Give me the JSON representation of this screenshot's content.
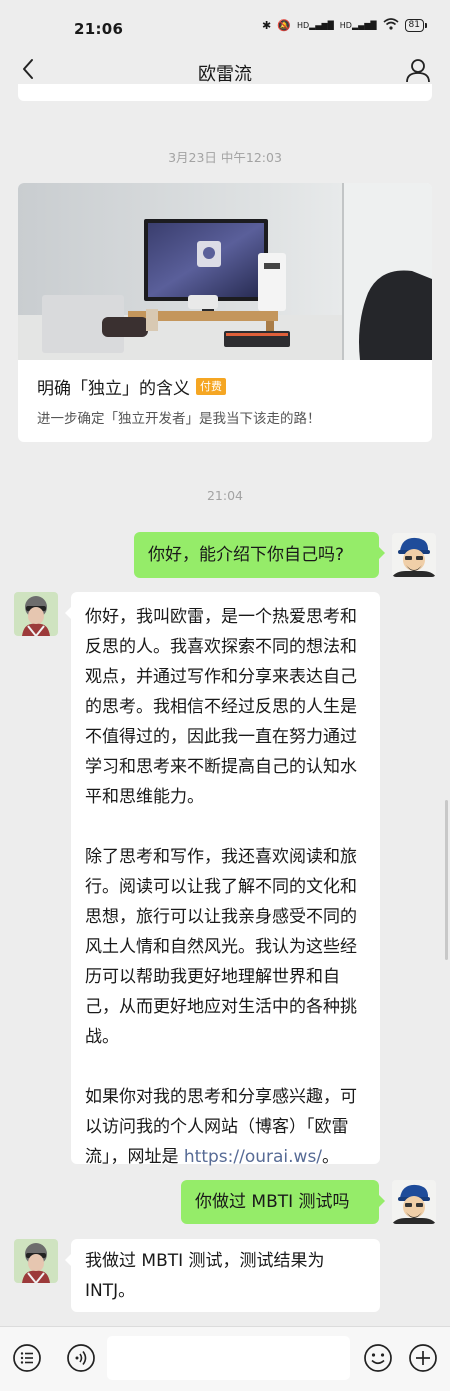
{
  "status": {
    "time": "21:06",
    "network1": "HD",
    "network2": "HD",
    "battery": "81"
  },
  "nav": {
    "title": "欧雷流"
  },
  "timestamps": {
    "first": "3月23日 中午12:03",
    "second": "21:04"
  },
  "article": {
    "title": "明确「独立」的含义",
    "badge": "付费",
    "description": "进一步确定「独立开发者」是我当下该走的路！"
  },
  "messages": {
    "q1": "你好，能介绍下你自己吗?",
    "a1_p1": "你好，我叫欧雷，是一个热爱思考和反思的人。我喜欢探索不同的想法和观点，并通过写作和分享来表达自己的思考。我相信不经过反思的人生是不值得过的，因此我一直在努力通过学习和思考来不断提高自己的认知水平和思维能力。",
    "a1_p2": "除了思考和写作，我还喜欢阅读和旅行。阅读可以让我了解不同的文化和思想，旅行可以让我亲身感受不同的风土人情和自然风光。我认为这些经历可以帮助我更好地理解世界和自己，从而更好地应对生活中的各种挑战。",
    "a1_p3_text": "如果你对我的思考和分享感兴趣，可以访问我的个人网站（博客）「欧雷流」，网址是 ",
    "a1_p3_link": "https://ourai.ws/",
    "a1_p3_end": "。",
    "q2": "你做过 MBTI 测试吗",
    "a2": "我做过 MBTI 测试，测试结果为 INTJ。"
  },
  "colors": {
    "my_bubble": "#95ec69",
    "background": "#ededed",
    "badge": "#f5a623",
    "link": "#576b95"
  }
}
